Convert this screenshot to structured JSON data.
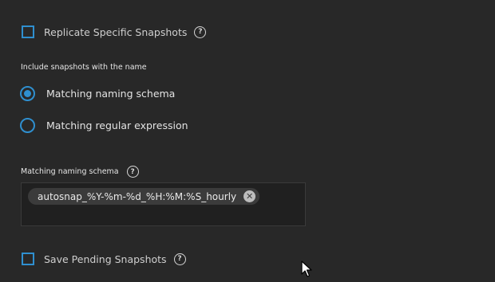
{
  "replicate_specific": {
    "label": "Replicate Specific Snapshots",
    "checked": false
  },
  "include_section": {
    "label": "Include snapshots with the name",
    "options": [
      {
        "label": "Matching naming schema",
        "selected": true
      },
      {
        "label": "Matching regular expression",
        "selected": false
      }
    ]
  },
  "naming_schema": {
    "label": "Matching naming schema",
    "chips": [
      "autosnap_%Y-%m-%d_%H:%M:%S_hourly"
    ]
  },
  "save_pending": {
    "label": "Save Pending Snapshots",
    "checked": false
  },
  "icons": {
    "help": "?",
    "remove": "✕"
  },
  "colors": {
    "accent": "#2f8fcf",
    "background": "#282828"
  }
}
